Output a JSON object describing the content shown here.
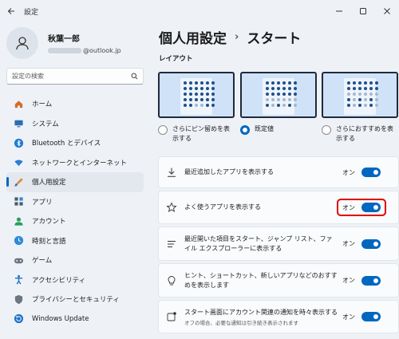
{
  "window": {
    "title": "設定"
  },
  "profile": {
    "name": "秋葉一郎",
    "email_suffix": "@outlook.jp"
  },
  "search": {
    "placeholder": "設定の検索"
  },
  "nav": {
    "items": [
      {
        "label": "ホーム",
        "icon": "home-icon",
        "color": "#d46b2a"
      },
      {
        "label": "システム",
        "icon": "system-icon",
        "color": "#2b6cb3"
      },
      {
        "label": "Bluetooth とデバイス",
        "icon": "bluetooth-icon",
        "color": "#1f7ad6"
      },
      {
        "label": "ネットワークとインターネット",
        "icon": "wifi-icon",
        "color": "#2a7fd4"
      },
      {
        "label": "個人用設定",
        "icon": "brush-icon",
        "color": "#e08a2e",
        "active": true
      },
      {
        "label": "アプリ",
        "icon": "apps-icon",
        "color": "#4a5a6c"
      },
      {
        "label": "アカウント",
        "icon": "account-icon",
        "color": "#27a05b"
      },
      {
        "label": "時刻と言語",
        "icon": "globe-clock-icon",
        "color": "#2f8ad8"
      },
      {
        "label": "ゲーム",
        "icon": "gamepad-icon",
        "color": "#6c7580"
      },
      {
        "label": "アクセシビリティ",
        "icon": "accessibility-icon",
        "color": "#1f6fc6"
      },
      {
        "label": "プライバシーとセキュリティ",
        "icon": "shield-icon",
        "color": "#6c7580"
      },
      {
        "label": "Windows Update",
        "icon": "update-icon",
        "color": "#1f73c9"
      }
    ]
  },
  "page": {
    "breadcrumb_parent": "個人用設定",
    "breadcrumb_sep": "›",
    "title": "スタート"
  },
  "layout_section": {
    "label": "レイアウト",
    "options": [
      {
        "label": "さらにピン留めを表示する",
        "selected": false
      },
      {
        "label": "既定値",
        "selected": true
      },
      {
        "label": "さらにおすすめを表示する",
        "selected": false
      }
    ]
  },
  "settings": [
    {
      "label": "最近追加したアプリを表示する",
      "sub": "",
      "state": "オン",
      "on": true,
      "icon": "download-icon",
      "highlighted": false
    },
    {
      "label": "よく使うアプリを表示する",
      "sub": "",
      "state": "オン",
      "on": true,
      "icon": "star-icon",
      "highlighted": true
    },
    {
      "label": "最近開いた項目をスタート、ジャンプ リスト、ファイル エクスプローラーに表示する",
      "sub": "",
      "state": "オン",
      "on": true,
      "icon": "list-icon",
      "highlighted": false
    },
    {
      "label": "ヒント、ショートカット、新しいアプリなどのおすすめを表示します",
      "sub": "",
      "state": "オン",
      "on": true,
      "icon": "lightbulb-icon",
      "highlighted": false
    },
    {
      "label": "スタート画面にアカウント関連の通知を時々表示する",
      "sub": "オフの場合、必要な通知は引き続き表示されます",
      "state": "オン",
      "on": true,
      "icon": "notification-icon",
      "highlighted": false
    }
  ],
  "accent_color": "#0067c0",
  "highlight_color": "#e00000"
}
